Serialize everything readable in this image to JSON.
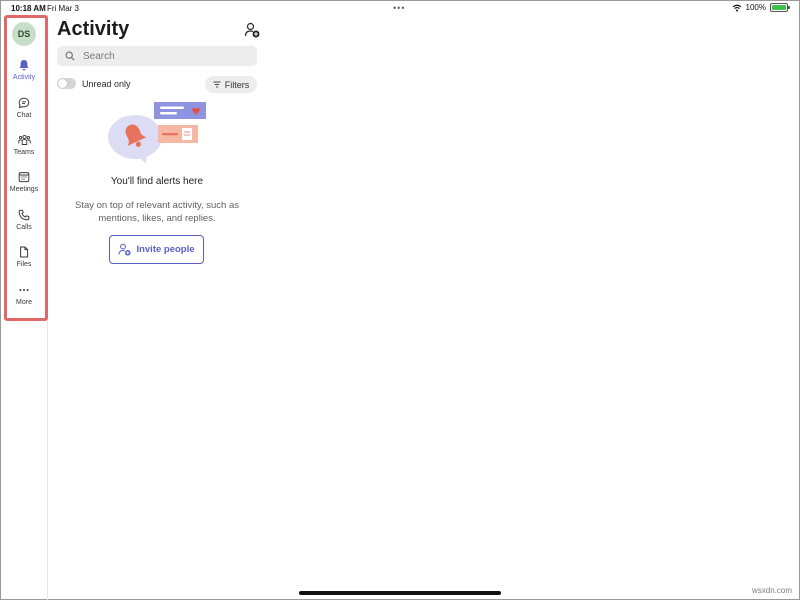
{
  "status_bar": {
    "time": "10:18 AM",
    "date": "Fri Mar 3",
    "battery": "100%",
    "icons": [
      "wifi-icon",
      "battery-icon"
    ]
  },
  "rail": {
    "avatar_initials": "DS",
    "items": [
      {
        "label": "Activity",
        "icon": "bell-icon",
        "active": true
      },
      {
        "label": "Chat",
        "icon": "chat-icon"
      },
      {
        "label": "Teams",
        "icon": "teams-icon"
      },
      {
        "label": "Meetings",
        "icon": "calendar-icon"
      },
      {
        "label": "Calls",
        "icon": "phone-icon"
      },
      {
        "label": "Files",
        "icon": "file-icon"
      },
      {
        "label": "More",
        "icon": "more-icon"
      }
    ]
  },
  "header": {
    "title": "Activity"
  },
  "search": {
    "placeholder": "Search"
  },
  "filter_bar": {
    "toggle_label": "Unread only",
    "toggle_on": false,
    "filters_label": "Filters"
  },
  "empty_state": {
    "title": "You'll find alerts here",
    "description": "Stay on top of relevant activity, such as mentions, likes, and replies.",
    "button_label": "Invite people"
  },
  "watermark": "wsxdn.com",
  "colors": {
    "accent": "#5b5fc7",
    "highlight_border": "#e06868",
    "avatar_bg": "#c7dfc9"
  }
}
